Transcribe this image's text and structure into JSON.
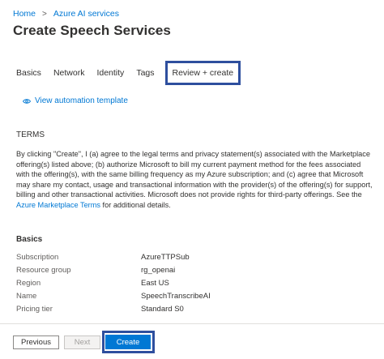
{
  "breadcrumb": {
    "items": [
      "Home",
      "Azure AI services"
    ],
    "separator": ">"
  },
  "page": {
    "title": "Create Speech Services",
    "more_label": "···"
  },
  "tabs": [
    {
      "label": "Basics",
      "active": false
    },
    {
      "label": "Network",
      "active": false
    },
    {
      "label": "Identity",
      "active": false
    },
    {
      "label": "Tags",
      "active": false
    },
    {
      "label": "Review + create",
      "active": true
    }
  ],
  "automation": {
    "label": "View automation template",
    "icon": "eye-icon"
  },
  "terms": {
    "heading": "TERMS",
    "body_before_link": "By clicking \"Create\", I (a) agree to the legal terms and privacy statement(s) associated with the Marketplace offering(s) listed above; (b) authorize Microsoft to bill my current payment method for the fees associated with the offering(s), with the same billing frequency as my Azure subscription; and (c) agree that Microsoft may share my contact, usage and transactional information with the provider(s) of the offering(s) for support, billing and other transactional activities. Microsoft does not provide rights for third-party offerings. See the ",
    "link_text": "Azure Marketplace Terms",
    "body_after_link": " for additional details."
  },
  "basics": {
    "heading": "Basics",
    "rows": [
      {
        "label": "Subscription",
        "value": "AzureTTPSub"
      },
      {
        "label": "Resource group",
        "value": "rg_openai"
      },
      {
        "label": "Region",
        "value": "East US"
      },
      {
        "label": "Name",
        "value": "SpeechTranscribeAI"
      },
      {
        "label": "Pricing tier",
        "value": "Standard S0"
      }
    ]
  },
  "footer": {
    "previous_label": "Previous",
    "next_label": "Next",
    "create_label": "Create"
  },
  "colors": {
    "accent": "#0078d4",
    "highlight_frame": "#2e4f9e"
  }
}
